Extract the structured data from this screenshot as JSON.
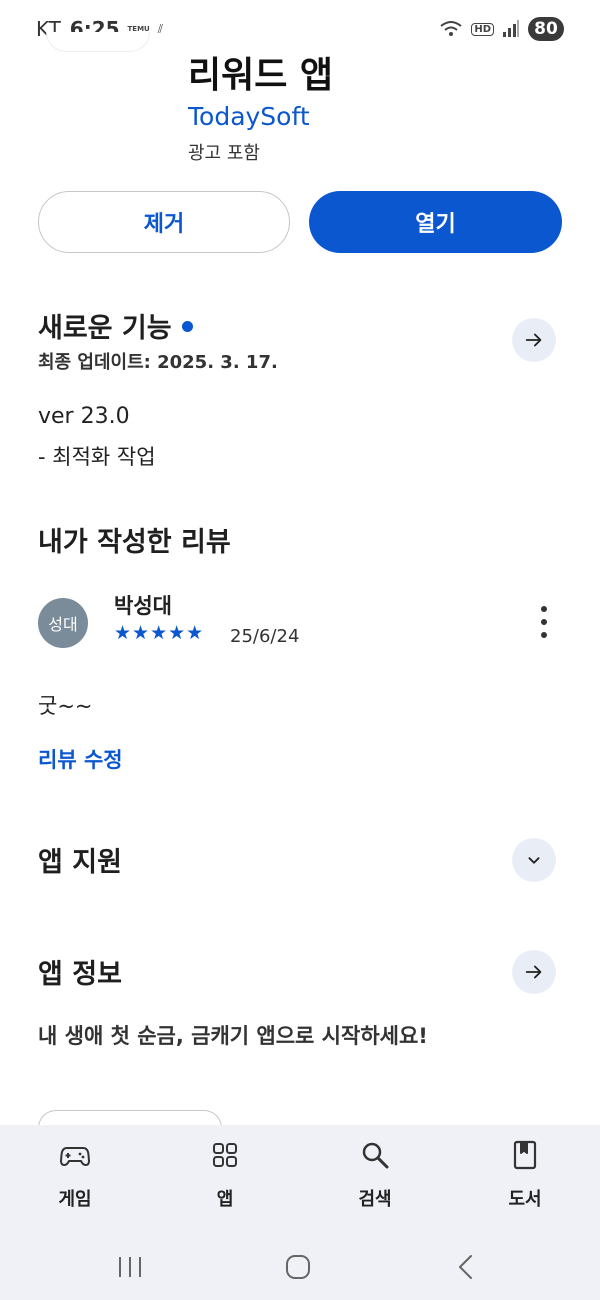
{
  "status_bar": {
    "carrier": "KT",
    "time": "6:25",
    "badge_text": "TEMU",
    "hd": "HD",
    "battery": "80"
  },
  "app": {
    "title": "리워드 앱",
    "developer": "TodaySoft",
    "ads_note": "광고 포함"
  },
  "actions": {
    "remove_label": "제거",
    "open_label": "열기"
  },
  "whats_new": {
    "title": "새로운 기능",
    "updated": "최종 업데이트: 2025. 3. 17.",
    "version": "ver 23.0",
    "changes": "- 최적화 작업"
  },
  "my_review": {
    "title": "내가 작성한 리뷰",
    "avatar_text": "성대",
    "reviewer": "박성대",
    "stars": "★★★★★",
    "rating": 5,
    "date": "25/6/24",
    "text": "굿~~",
    "edit_label": "리뷰 수정"
  },
  "app_support": {
    "title": "앱 지원"
  },
  "about": {
    "title": "앱 정보",
    "description": "내 생애 첫 순금, 금캐기 앱으로 시작하세요!"
  },
  "bottom_nav": {
    "items": [
      {
        "label": "게임",
        "icon": "gamepad-icon"
      },
      {
        "label": "앱",
        "icon": "apps-grid-icon"
      },
      {
        "label": "검색",
        "icon": "search-icon"
      },
      {
        "label": "도서",
        "icon": "book-icon"
      }
    ]
  },
  "colors": {
    "accent": "#0b57d0",
    "round_button_bg": "#e9eef6",
    "nav_bg": "#eff1f7"
  }
}
